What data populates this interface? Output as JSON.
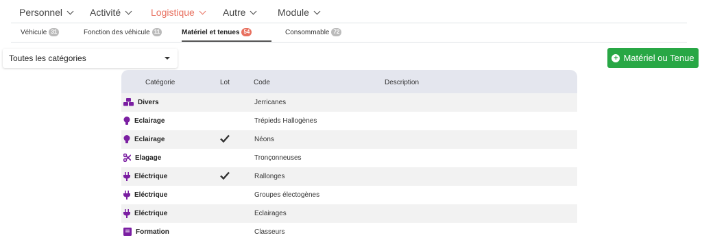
{
  "topnav": {
    "items": [
      {
        "label": "Personnel"
      },
      {
        "label": "Activité"
      },
      {
        "label": "Logistique"
      },
      {
        "label": "Autre"
      },
      {
        "label": "Module"
      }
    ]
  },
  "subnav": {
    "tabs": [
      {
        "label": "Véhicule",
        "count": "31"
      },
      {
        "label": "Fonction des véhicule",
        "count": "11"
      },
      {
        "label": "Matériel et tenues",
        "count": "54"
      },
      {
        "label": "Consommable",
        "count": "72"
      }
    ]
  },
  "filter": {
    "selected": "Toutes les catégories"
  },
  "add_button": {
    "label": "Matériel ou Tenue"
  },
  "table": {
    "headers": {
      "category": "Catégorie",
      "lot": "Lot",
      "code": "Code",
      "description": "Description"
    },
    "rows": [
      {
        "category": "Divers",
        "icon": "cubes-icon",
        "lot": false,
        "code": "Jerricanes"
      },
      {
        "category": "Eclairage",
        "icon": "lightbulb-icon",
        "lot": false,
        "code": "Trépieds Hallogènes"
      },
      {
        "category": "Eclairage",
        "icon": "lightbulb-icon",
        "lot": true,
        "code": "Néons"
      },
      {
        "category": "Elagage",
        "icon": "scissors-icon",
        "lot": false,
        "code": "Tronçonneuses"
      },
      {
        "category": "Eléctrique",
        "icon": "plug-icon",
        "lot": true,
        "code": "Rallonges"
      },
      {
        "category": "Eléctrique",
        "icon": "plug-icon",
        "lot": false,
        "code": "Groupes électogènes"
      },
      {
        "category": "Eléctrique",
        "icon": "plug-icon",
        "lot": false,
        "code": "Eclairages"
      },
      {
        "category": "Formation",
        "icon": "book-icon",
        "lot": false,
        "code": "Classeurs"
      }
    ]
  },
  "colors": {
    "accent": "#e8705f",
    "icon": "#7b1fa2",
    "success": "#28a745"
  }
}
